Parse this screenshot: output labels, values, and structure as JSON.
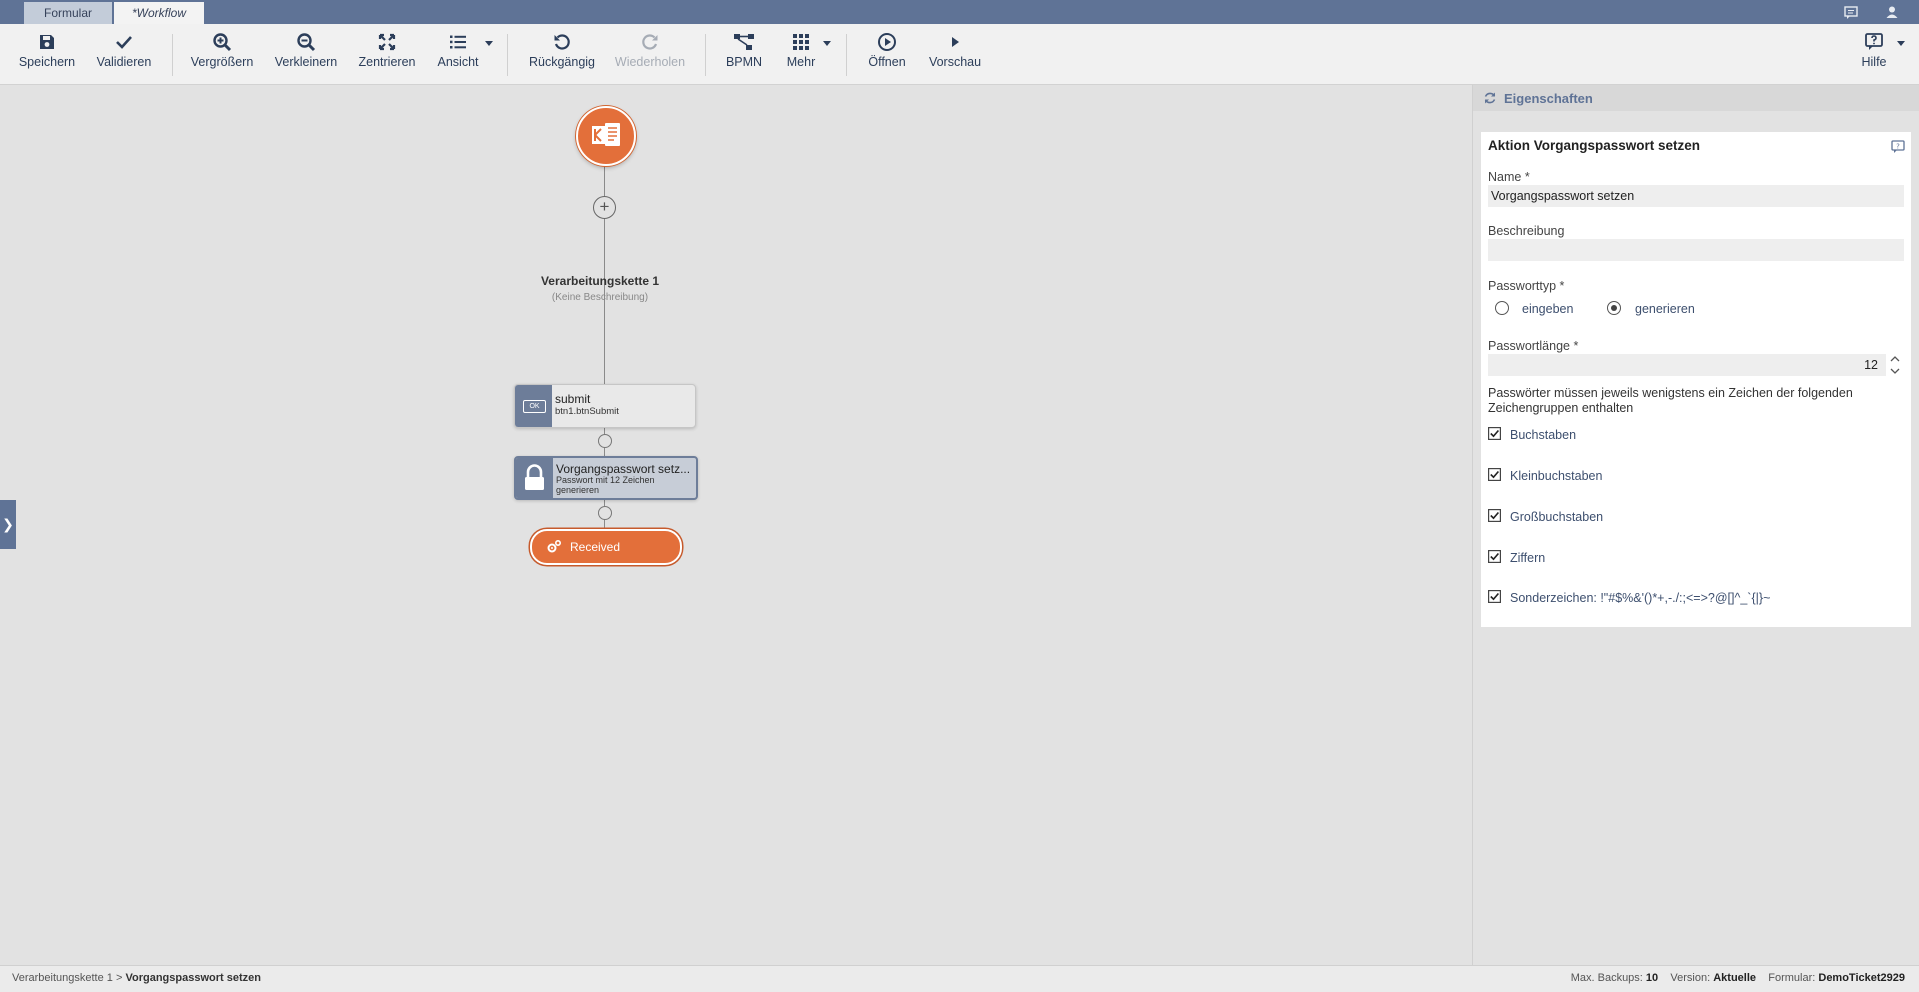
{
  "tabs": [
    {
      "label": "Formular"
    },
    {
      "label": "*Workflow"
    }
  ],
  "toolbar": {
    "save": "Speichern",
    "validate": "Validieren",
    "zoom_in": "Vergrößern",
    "zoom_out": "Verkleinern",
    "center": "Zentrieren",
    "view": "Ansicht",
    "undo": "Rückgängig",
    "redo": "Wiederholen",
    "bpmn": "BPMN",
    "more": "Mehr",
    "open": "Öffnen",
    "preview": "Vorschau",
    "help": "Hilfe"
  },
  "canvas": {
    "chain_title": "Verarbeitungskette 1",
    "chain_desc": "(Keine Beschreibung)",
    "node_submit": {
      "title": "submit",
      "sub": "btn1.btnSubmit",
      "icon_text": "OK"
    },
    "node_password": {
      "title": "Vorgangspasswort setz...",
      "sub": "Passwort mit 12 Zeichen generieren"
    },
    "end_node": {
      "label": "Received"
    }
  },
  "panel": {
    "title": "Eigenschaften",
    "card_title": "Aktion Vorgangspasswort setzen",
    "name_label": "Name *",
    "name_value": "Vorgangspasswort setzen",
    "desc_label": "Beschreibung",
    "desc_value": "",
    "pwtype_label": "Passworttyp *",
    "pwtype_options": [
      {
        "label": "eingeben",
        "selected": false
      },
      {
        "label": "generieren",
        "selected": true
      }
    ],
    "pwlength_label": "Passwortlänge *",
    "pwlength_value": "12",
    "note": "Passwörter müssen jeweils wenigstens ein Zeichen der folgenden Zeichengruppen enthalten",
    "groups": [
      {
        "label": "Buchstaben",
        "checked": true
      },
      {
        "label": "Kleinbuchstaben",
        "checked": true
      },
      {
        "label": "Großbuchstaben",
        "checked": true
      },
      {
        "label": "Ziffern",
        "checked": true
      },
      {
        "label": "Sonderzeichen: !\"#$%&'()*+,-./:;<=>?@[]^_`{|}~",
        "checked": true
      }
    ]
  },
  "statusbar": {
    "crumb_parent": "Verarbeitungskette 1",
    "crumb_sep": ">",
    "crumb_current": "Vorgangspasswort setzen",
    "backups_label": "Max. Backups:",
    "backups_value": "10",
    "version_label": "Version:",
    "version_value": "Aktuelle",
    "form_label": "Formular:",
    "form_value": "DemoTicket2929"
  },
  "colors": {
    "brand": "#5f7396",
    "accent": "#e36f3a"
  }
}
